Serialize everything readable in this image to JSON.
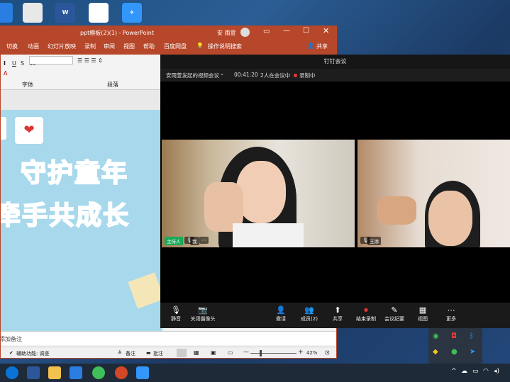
{
  "powerpoint": {
    "title": "ppt模板(2)(1) - PowerPoint",
    "user": "安 雨萱",
    "tabs": [
      "切换",
      "动画",
      "幻灯片放映",
      "录制",
      "审阅",
      "视图",
      "帮助",
      "百度网盘"
    ],
    "tell_me": "操作说明搜索",
    "share": "共享",
    "groups": [
      "字体",
      "段落"
    ],
    "slide_line1": "守护童年",
    "slide_line2": "牵手共成长",
    "notes_placeholder": "添加备注",
    "status_accessibility": "辅助功能: 调查",
    "status_notes": "备注",
    "status_comments": "批注",
    "zoom": "42%"
  },
  "meeting": {
    "title": "钉钉会议",
    "meeting_name": "安雨萱发起的视频会议",
    "duration": "00:41:20",
    "participants": "2人在会议中",
    "recording": "录制中",
    "host_badge": "主持人",
    "self_label": "我",
    "other_label": "王添",
    "toolbar": [
      {
        "icon": "mic-icon",
        "label": "静音",
        "glyph": "🎙"
      },
      {
        "icon": "camera-icon",
        "label": "关闭摄像头",
        "glyph": "📷"
      },
      {
        "icon": "invite-icon",
        "label": "邀请",
        "glyph": "👤"
      },
      {
        "icon": "members-icon",
        "label": "成员(2)",
        "glyph": "👥"
      },
      {
        "icon": "share-icon",
        "label": "共享",
        "glyph": "⬆"
      },
      {
        "icon": "record-icon",
        "label": "结束录制",
        "glyph": "⏺"
      },
      {
        "icon": "minutes-icon",
        "label": "会议纪要",
        "glyph": "✎"
      },
      {
        "icon": "view-icon",
        "label": "视图",
        "glyph": "▦"
      },
      {
        "icon": "more-icon",
        "label": "更多",
        "glyph": "⋯"
      }
    ]
  },
  "colors": {
    "ppt_red": "#b7472a",
    "meeting_bg": "#000000",
    "record_red": "#e53935"
  }
}
